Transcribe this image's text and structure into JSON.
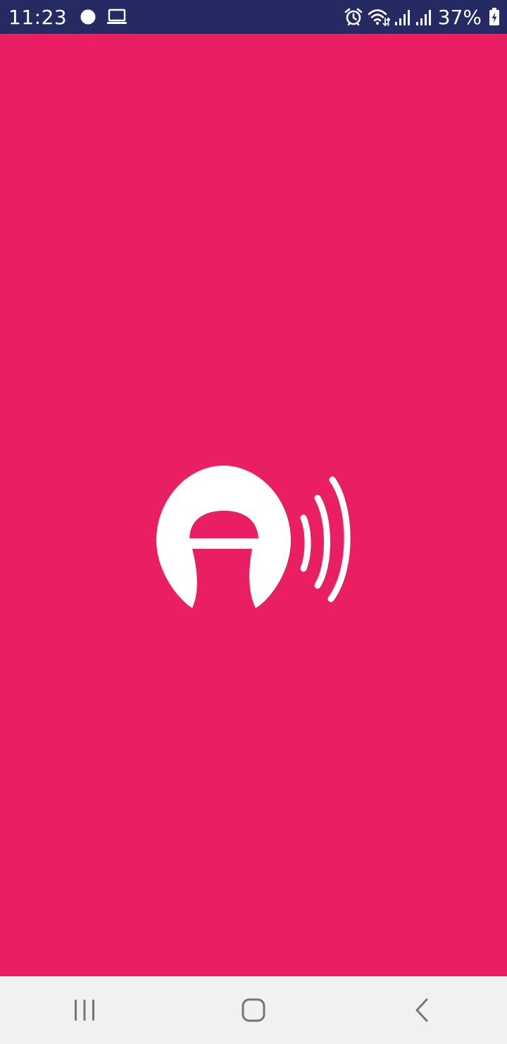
{
  "colors": {
    "status_bar_bg": "#262a63",
    "splash_bg": "#e91e63",
    "logo_fg": "#ffffff",
    "nav_bar_bg": "#f1f1f1",
    "nav_icon": "#757575"
  },
  "status_bar": {
    "time": "11:23",
    "left_icons": [
      "circle-notification-icon",
      "laptop-icon"
    ],
    "right_icons": [
      "alarm-icon",
      "wifi-icon",
      "signal-1-icon",
      "signal-2-icon"
    ],
    "battery_percent": "37%",
    "battery_icon": "battery-charging-icon"
  },
  "splash": {
    "logo_icon": "app-logo-icon"
  },
  "nav_bar": {
    "buttons": [
      {
        "icon": "recent-apps-icon"
      },
      {
        "icon": "home-icon"
      },
      {
        "icon": "back-icon"
      }
    ]
  }
}
